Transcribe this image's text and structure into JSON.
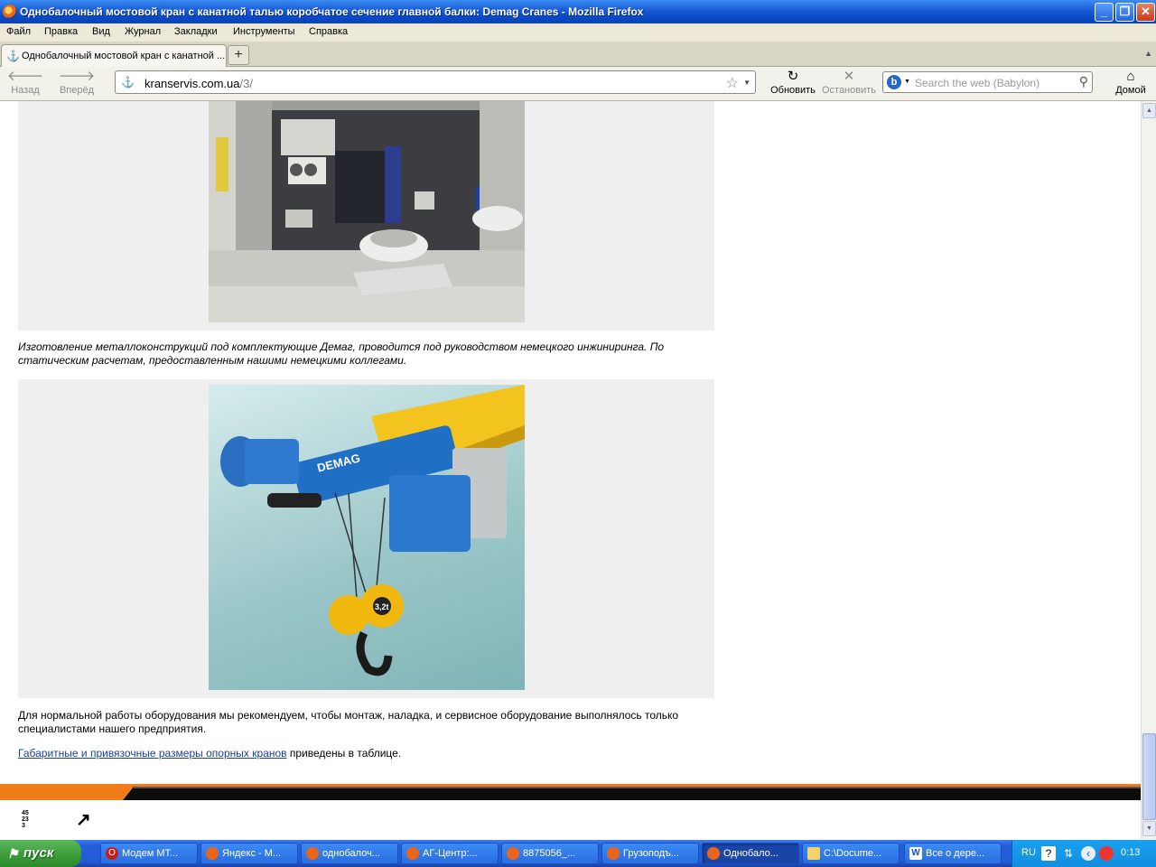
{
  "window": {
    "title": "Однобалочный мостовой кран с канатной талью коробчатое сечение главной балки: Demag Cranes - Mozilla Firefox",
    "minimize_label": "_",
    "maximize_label": "❐",
    "close_label": "✕"
  },
  "menu": [
    "Файл",
    "Правка",
    "Вид",
    "Журнал",
    "Закладки",
    "Инструменты",
    "Справка"
  ],
  "tabs": {
    "active_label": "Однобалочный мостовой кран с канатной ...",
    "new_tab_label": "+"
  },
  "nav": {
    "back_label": "Назад",
    "forward_label": "Вперёд",
    "reload_label": "Обновить",
    "stop_label": "Остановить",
    "home_label": "Домой",
    "url_host": "kranservis.com.ua",
    "url_path": "/3/",
    "search_placeholder": "Search the web (Babylon)"
  },
  "content": {
    "caption_1": "Изготовление металлоконструкций под комплектующие Демаг, проводится под руководством немецкого инжиниринга. По статическим расчетам, предоставленным нашими немецкими коллегами.",
    "paragraph": "Для нормальной работы оборудования мы рекомендуем, чтобы монтаж, наладка, и сервисное оборудование выполнялось только специалистами нашего предприятия.",
    "link_text": "Габаритные и привязочные размеры опорных кранов",
    "link_suffix": " приведены в таблице.",
    "hoist_brand": "DEMAG",
    "hoist_capacity": "3,2t",
    "footer_logo_lines": [
      "45",
      "23",
      "3"
    ],
    "footer_arrow": "↗"
  },
  "taskbar": {
    "start_label": "пуск",
    "tasks": [
      {
        "label": "Модем МТ...",
        "icon": "opera-icon"
      },
      {
        "label": "Яндекс - М...",
        "icon": "firefox-icon"
      },
      {
        "label": "однобалоч...",
        "icon": "firefox-icon"
      },
      {
        "label": "АГ-Центр:...",
        "icon": "firefox-icon"
      },
      {
        "label": "8875056_...",
        "icon": "firefox-icon"
      },
      {
        "label": "Грузоподъ...",
        "icon": "firefox-icon"
      },
      {
        "label": "Однобало...",
        "icon": "firefox-icon"
      },
      {
        "label": "C:\\Docume...",
        "icon": "folder-icon"
      },
      {
        "label": "Все о дере...",
        "icon": "word-icon"
      }
    ],
    "lang": "RU",
    "clock": "0:13"
  },
  "colors": {
    "accent_orange": "#f07c1a",
    "link_blue": "#1a3e9c",
    "xp_blue": "#245edb"
  }
}
